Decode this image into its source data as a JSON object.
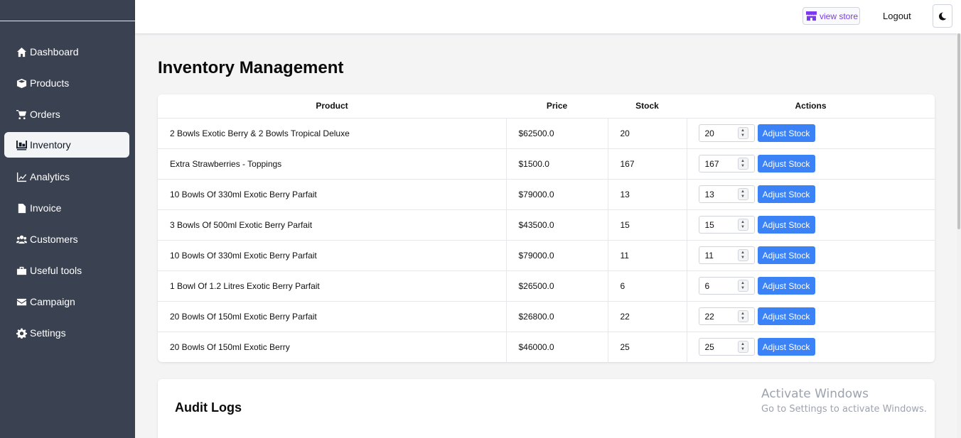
{
  "sidebar": {
    "items": [
      {
        "label": "Dashboard",
        "icon": "home-icon"
      },
      {
        "label": "Products",
        "icon": "box-icon"
      },
      {
        "label": "Orders",
        "icon": "cart-icon"
      },
      {
        "label": "Inventory",
        "icon": "pallet-icon",
        "active": true
      },
      {
        "label": "Analytics",
        "icon": "line-chart-icon"
      },
      {
        "label": "Invoice",
        "icon": "file-icon"
      },
      {
        "label": "Customers",
        "icon": "users-icon"
      },
      {
        "label": "Useful tools",
        "icon": "toolbox-icon"
      },
      {
        "label": "Campaign",
        "icon": "envelope-icon"
      },
      {
        "label": "Settings",
        "icon": "gear-icon"
      }
    ]
  },
  "header": {
    "view_store": "view store",
    "logout": "Logout",
    "theme_toggle_icon": "moon-icon"
  },
  "main": {
    "title": "Inventory Management",
    "table": {
      "columns": [
        "Product",
        "Price",
        "Stock",
        "Actions"
      ],
      "action_label": "Adjust Stock",
      "rows": [
        {
          "product": "2 Bowls Exotic Berry & 2 Bowls Tropical Deluxe",
          "price": "$62500.0",
          "stock": "20",
          "input": "20"
        },
        {
          "product": "Extra Strawberries - Toppings",
          "price": "$1500.0",
          "stock": "167",
          "input": "167"
        },
        {
          "product": "10 Bowls Of 330ml Exotic Berry Parfait",
          "price": "$79000.0",
          "stock": "13",
          "input": "13"
        },
        {
          "product": "3 Bowls Of 500ml Exotic Berry Parfait",
          "price": "$43500.0",
          "stock": "15",
          "input": "15"
        },
        {
          "product": "10 Bowls Of 330ml Exotic Berry Parfait",
          "price": "$79000.0",
          "stock": "11",
          "input": "11"
        },
        {
          "product": "1 Bowl Of 1.2 Litres Exotic Berry Parfait",
          "price": "$26500.0",
          "stock": "6",
          "input": "6"
        },
        {
          "product": "20 Bowls Of 150ml Exotic Berry Parfait",
          "price": "$26800.0",
          "stock": "22",
          "input": "22"
        },
        {
          "product": "20 Bowls Of 150ml Exotic Berry",
          "price": "$46000.0",
          "stock": "25",
          "input": "25"
        }
      ]
    },
    "audit_title": "Audit Logs"
  },
  "watermark": {
    "line1": "Activate Windows",
    "line2": "Go to Settings to activate Windows."
  },
  "colors": {
    "sidebar_bg": "#3a4150",
    "accent_button": "#3b82f6",
    "view_store": "#7c3aed"
  }
}
